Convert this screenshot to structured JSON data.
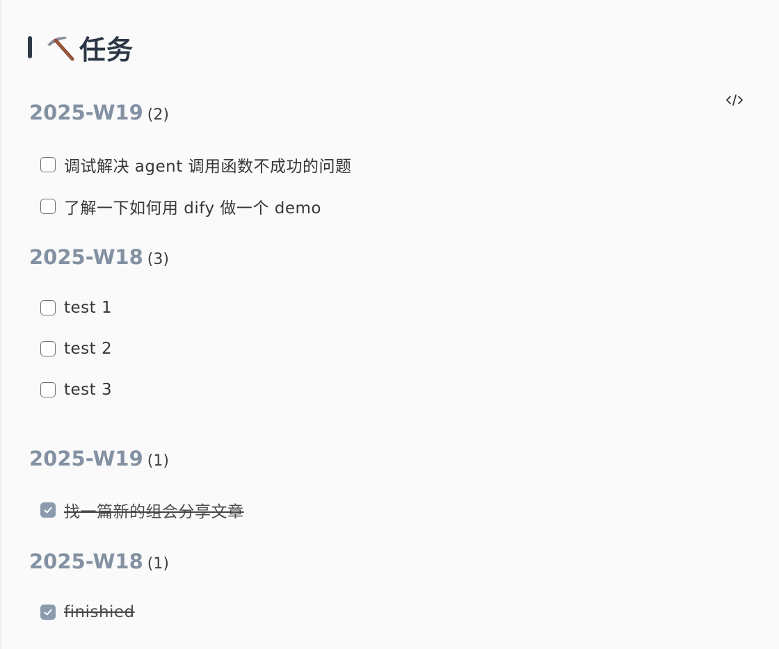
{
  "page": {
    "title": "任务",
    "icon": "pick-icon"
  },
  "toolbar": {
    "code_icon": "code-icon"
  },
  "colors": {
    "heading": "#8391a3",
    "title": "#2b3645",
    "checked": "#8b9bad",
    "background": "#fafafa"
  },
  "open_groups": [
    {
      "week": "2025-W19",
      "count": "(2)",
      "tasks": [
        {
          "text": "调试解决 agent 调用函数不成功的问题",
          "checked": false
        },
        {
          "text": "了解一下如何用 dify 做一个 demo",
          "checked": false
        }
      ]
    },
    {
      "week": "2025-W18",
      "count": "(3)",
      "tasks": [
        {
          "text": "test 1",
          "checked": false
        },
        {
          "text": "test 2",
          "checked": false
        },
        {
          "text": "test 3",
          "checked": false
        }
      ]
    }
  ],
  "done_groups": [
    {
      "week": "2025-W19",
      "count": "(1)",
      "tasks": [
        {
          "text": "找一篇新的组会分享文章",
          "checked": true
        }
      ]
    },
    {
      "week": "2025-W18",
      "count": "(1)",
      "tasks": [
        {
          "text": "finishied",
          "checked": true
        }
      ]
    }
  ]
}
